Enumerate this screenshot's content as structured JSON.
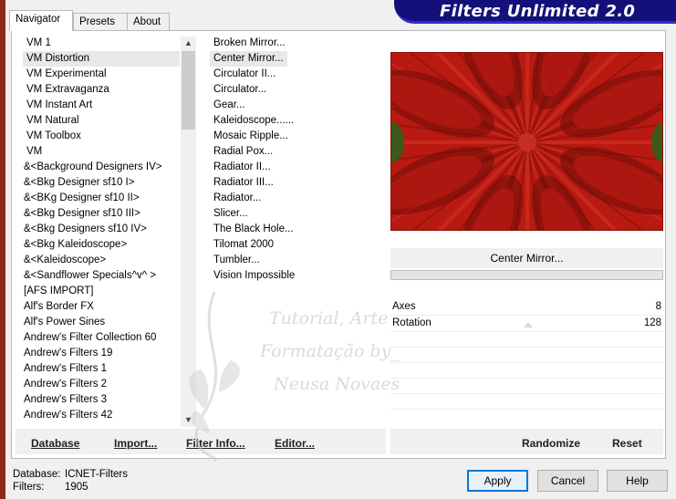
{
  "window": {
    "title": "Filters Unlimited 2.0"
  },
  "tabs": [
    {
      "label": "Navigator"
    },
    {
      "label": "Presets"
    },
    {
      "label": "About"
    }
  ],
  "categories": {
    "items": [
      "VM 1",
      "VM Distortion",
      "VM Experimental",
      "VM Extravaganza",
      "VM Instant Art",
      "VM Natural",
      "VM Toolbox",
      "VM",
      "&<Background Designers IV>",
      "&<Bkg Designer sf10 I>",
      "&<BKg Designer sf10 II>",
      "&<Bkg Designer sf10 III>",
      "&<Bkg Designers sf10 IV>",
      "&<Bkg Kaleidoscope>",
      "&<Kaleidoscope>",
      "&<Sandflower Specials^v^ >",
      "[AFS IMPORT]",
      "Alf's Border FX",
      "Alf's Power Sines",
      "Andrew's Filter Collection 60",
      "Andrew's Filters 19",
      "Andrew's Filters 1",
      "Andrew's Filters 2",
      "Andrew's Filters 3",
      "Andrew's Filters 42"
    ],
    "selected": "VM Distortion"
  },
  "filters": {
    "items": [
      "Broken Mirror...",
      "Center Mirror...",
      "Circulator II...",
      "Circulator...",
      "Gear...",
      "Kaleidoscope......",
      "Mosaic Ripple...",
      "Radial Pox...",
      "Radiator II...",
      "Radiator III...",
      "Radiator...",
      "Slicer...",
      "The Black Hole...",
      "Tilomat 2000",
      "Tumbler...",
      "Vision Impossible"
    ],
    "selected": "Center Mirror..."
  },
  "list_buttons": {
    "database": "Database",
    "import": "Import...",
    "filter_info": "Filter Info...",
    "editor": "Editor..."
  },
  "preview": {
    "filter_name": "Center Mirror...",
    "colors": {
      "base": "#b81a12",
      "dark": "#6e0d08",
      "light": "#e0382a",
      "edge": "#3b5a1a"
    }
  },
  "params": [
    {
      "label": "Axes",
      "value": "8"
    },
    {
      "label": "Rotation",
      "value": "128"
    }
  ],
  "right_buttons": {
    "randomize": "Randomize",
    "reset": "Reset"
  },
  "status": {
    "database_label": "Database:",
    "database_value": "ICNET-Filters",
    "filters_label": "Filters:",
    "filters_value": "1905"
  },
  "dialog_buttons": {
    "apply": "Apply",
    "cancel": "Cancel",
    "help": "Help"
  },
  "watermark": {
    "line1": "Tutorial, Arte",
    "line2": "Formatação by_",
    "line3": "Neusa Novaes"
  }
}
